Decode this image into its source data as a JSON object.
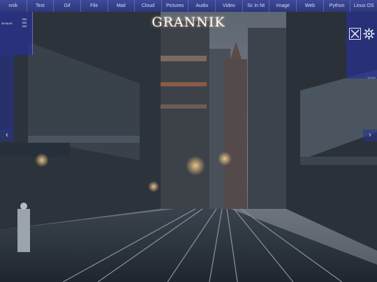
{
  "nav": {
    "items": [
      "nnik",
      "Text",
      "Gif",
      "File",
      "Mail",
      "Cloud",
      "Pictures",
      "Audio",
      "Video",
      "Sc In Nt",
      "Image",
      "Web",
      "Python",
      "Linux OS"
    ]
  },
  "header": {
    "logo": "GRANNIK"
  },
  "left_panel": {
    "clock": "00:00:00",
    "counter": [
      "000",
      "000",
      "000"
    ]
  },
  "right_panel": {
    "text": "hr ht h"
  },
  "controls": {
    "prev": "‹",
    "next": "›"
  },
  "colors": {
    "nav_bg": "#2c377c",
    "panel_bg": "#2830a0",
    "scene_sky": "#69717c",
    "scene_ground": "#1f252c"
  },
  "icons": [
    "close-x-icon",
    "settings-gear-icon",
    "prev-arrow-icon",
    "next-arrow-icon"
  ]
}
